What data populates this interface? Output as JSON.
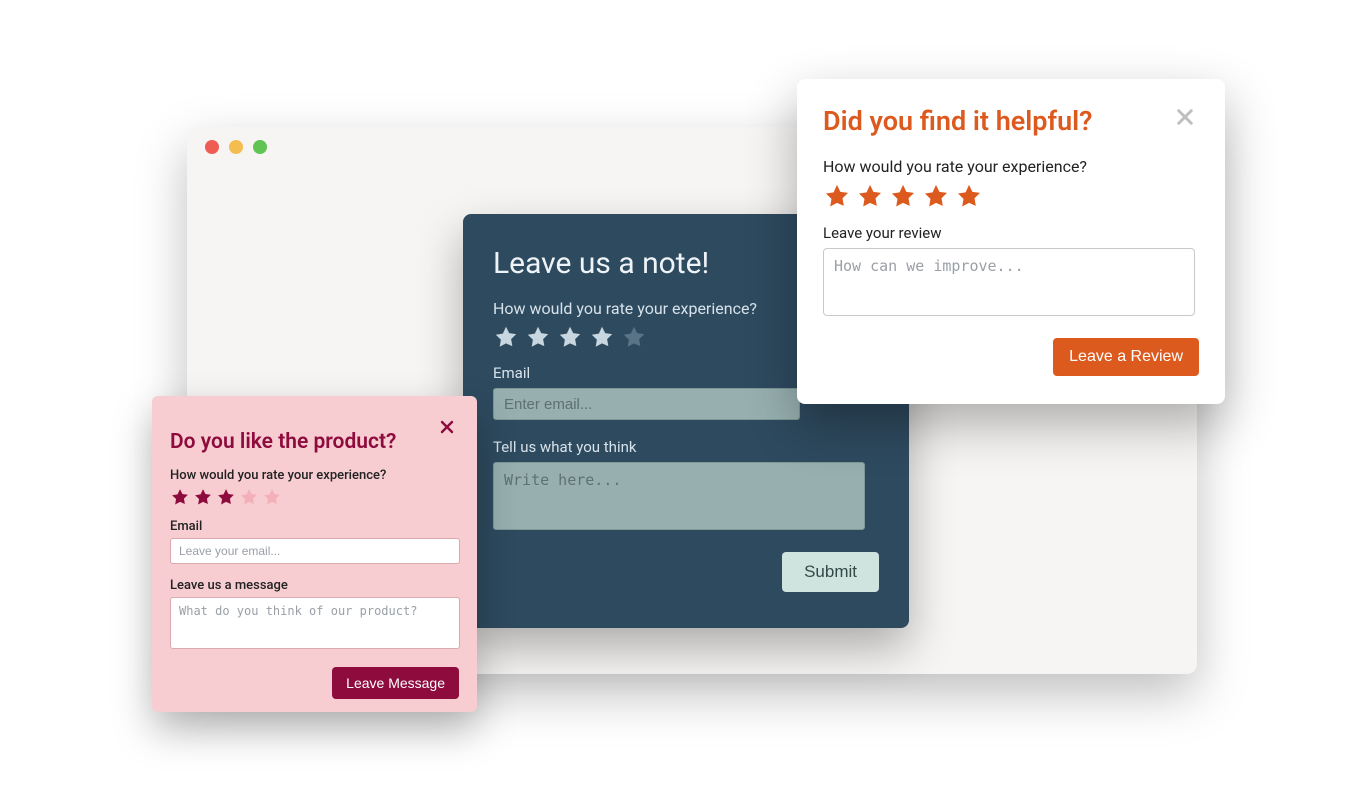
{
  "colors": {
    "center_bg": "#2e4a5f",
    "center_input": "#97afaf",
    "center_button": "#cfe4df",
    "pink_bg": "#f7cdd1",
    "pink_accent": "#8e0b3e",
    "white_accent": "#dd5a1f"
  },
  "center": {
    "title": "Leave us a note!",
    "rate_question": "How would you rate your experience?",
    "rating_value": 4,
    "rating_max": 5,
    "email_label": "Email",
    "email_placeholder": "Enter email...",
    "message_label": "Tell us what you think",
    "message_placeholder": "Write here...",
    "submit_label": "Submit"
  },
  "pink": {
    "title": "Do you like the product?",
    "rate_question": "How would you rate your experience?",
    "rating_value": 3,
    "rating_max": 5,
    "email_label": "Email",
    "email_placeholder": "Leave your email...",
    "message_label": "Leave us a message",
    "message_placeholder": "What do you think of our product?",
    "submit_label": "Leave Message"
  },
  "white": {
    "title": "Did you find it helpful?",
    "rate_question": "How would you rate your experience?",
    "rating_value": 5,
    "rating_max": 5,
    "message_label": "Leave your review",
    "message_placeholder": "How can we improve...",
    "submit_label": "Leave a Review"
  }
}
